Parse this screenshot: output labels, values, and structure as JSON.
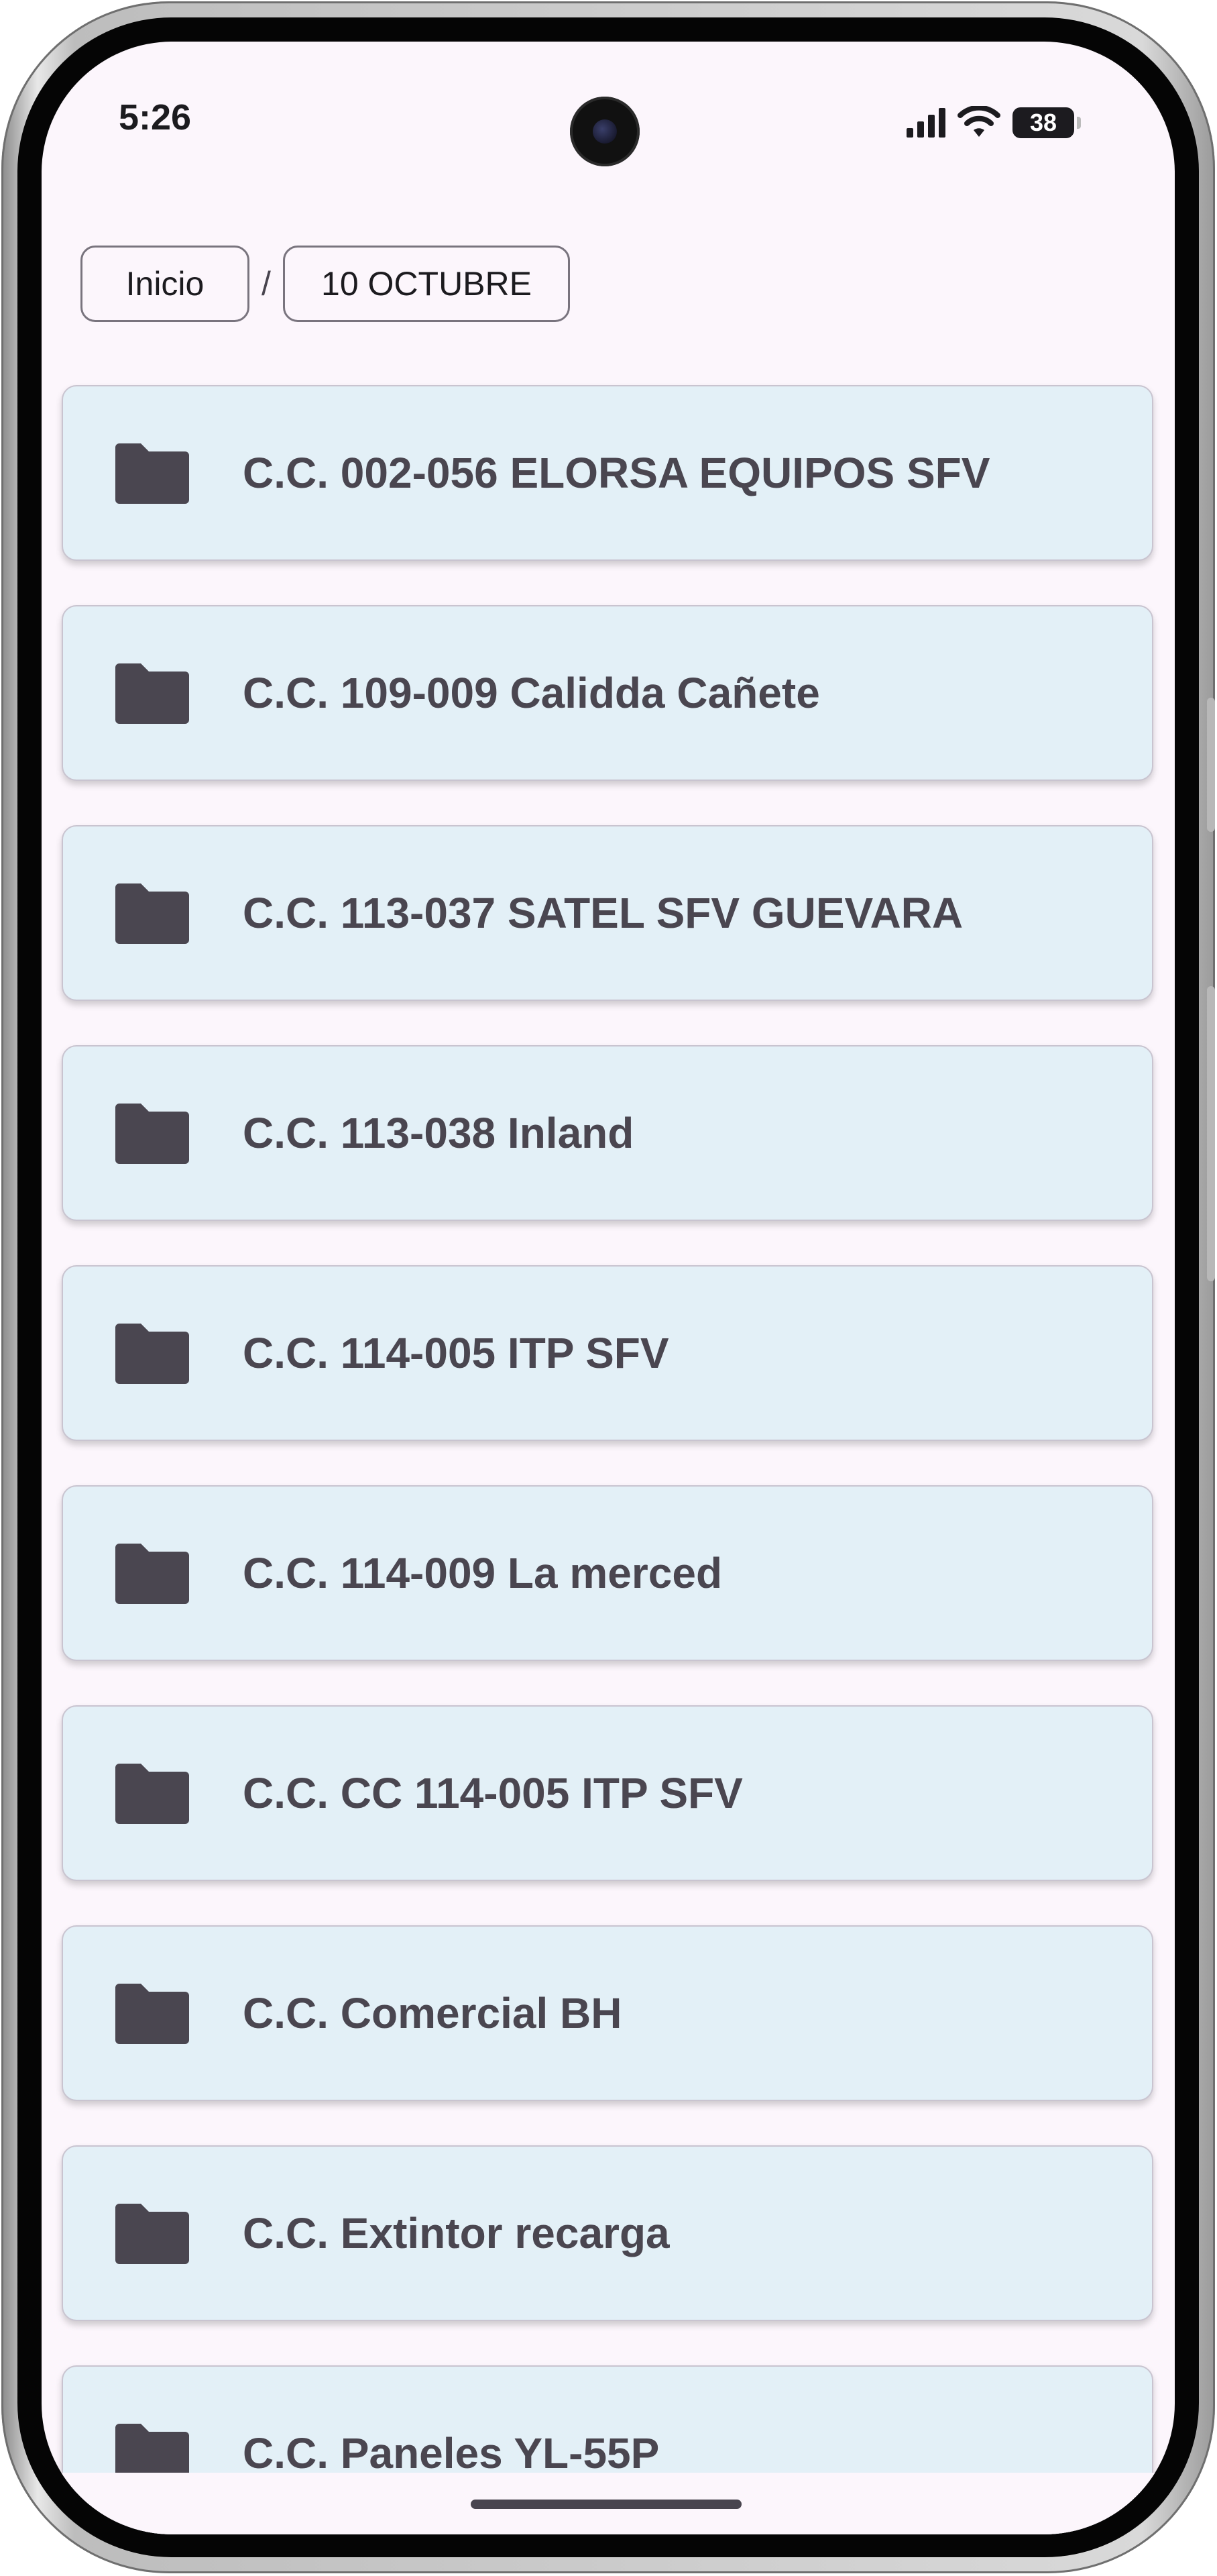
{
  "status_bar": {
    "time": "5:26",
    "battery": "38"
  },
  "breadcrumb": {
    "home": "Inicio",
    "separator": "/",
    "current": "10 OCTUBRE"
  },
  "folders": [
    {
      "label": "C.C. 002-056 ELORSA EQUIPOS SFV",
      "icon": "folder-icon"
    },
    {
      "label": "C.C. 109-009 Calidda Cañete",
      "icon": "folder-icon"
    },
    {
      "label": "C.C. 113-037 SATEL SFV GUEVARA",
      "icon": "folder-icon"
    },
    {
      "label": "C.C. 113-038 Inland",
      "icon": "folder-icon"
    },
    {
      "label": "C.C. 114-005 ITP SFV",
      "icon": "folder-icon"
    },
    {
      "label": "C.C. 114-009 La merced",
      "icon": "folder-icon"
    },
    {
      "label": "C.C. CC 114-005 ITP SFV",
      "icon": "folder-icon"
    },
    {
      "label": "C.C. Comercial BH",
      "icon": "folder-icon"
    },
    {
      "label": "C.C. Extintor recarga",
      "icon": "folder-icon"
    },
    {
      "label": "C.C. Paneles YL-55P",
      "icon": "folder-icon"
    }
  ],
  "colors": {
    "card_bg": "#e3f0f7",
    "screen_bg": "#fcf6fc",
    "icon": "#4a4650"
  }
}
